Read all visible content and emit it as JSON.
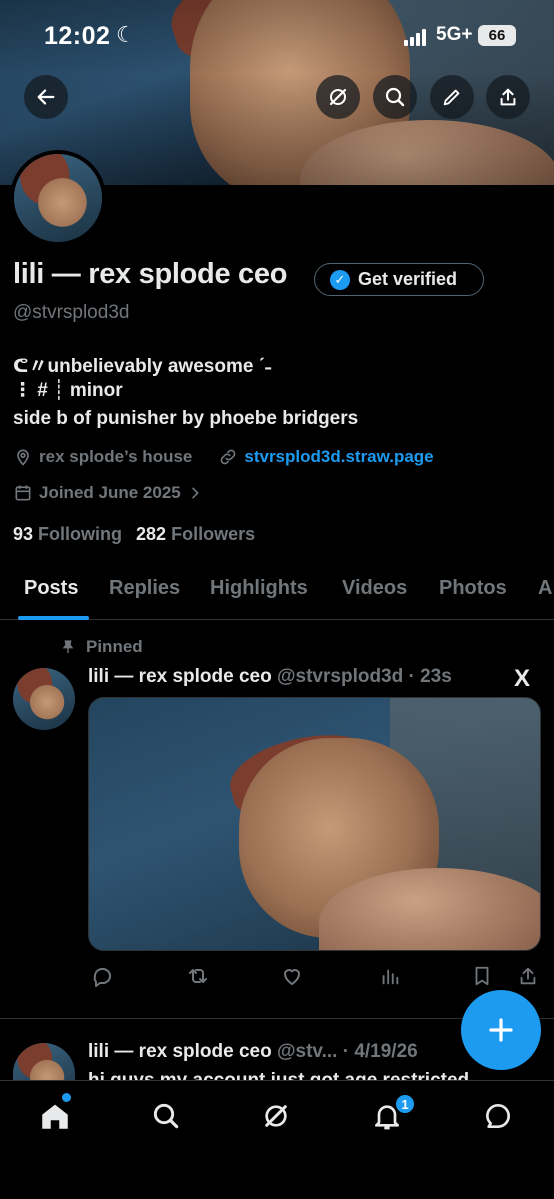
{
  "status_bar": {
    "time": "12:02",
    "moon": "☾",
    "network": "5G+",
    "battery": "66"
  },
  "profile": {
    "name": "lili — rex splode ceo",
    "verify_label": "Get verified",
    "handle": "@stvrsplod3d",
    "bio_line1": "ᕦ〃unbelievably awesome ˊ˗",
    "bio_line2": "⋮ # ┊ minor",
    "bio_line3": "side b of punisher by phoebe bridgers",
    "location": "rex splode’s house",
    "link": "stvrsplod3d.straw.page",
    "joined": "Joined June 2025",
    "following_count": "93",
    "following_label": "Following",
    "followers_count": "282",
    "followers_label": "Followers"
  },
  "tabs": [
    {
      "label": "Posts"
    },
    {
      "label": "Replies"
    },
    {
      "label": "Highlights"
    },
    {
      "label": "Videos"
    },
    {
      "label": "Photos"
    },
    {
      "label": "A"
    }
  ],
  "posts": [
    {
      "pinned_label": "Pinned",
      "author": "lili — rex splode ceo",
      "meta": "@stvrsplod3d · 23s",
      "source_logo": "X"
    },
    {
      "author": "lili — rex splode ceo",
      "meta": "@stv... · 4/19/26",
      "text": "hi guys my account just got age restricted"
    }
  ],
  "fab": {
    "symbol": "+"
  },
  "bottom_nav": {
    "notification_count": "1"
  },
  "colors": {
    "accent": "#1d9bf0",
    "background": "#000000",
    "muted": "#71767b",
    "text": "#e7e9ea"
  }
}
